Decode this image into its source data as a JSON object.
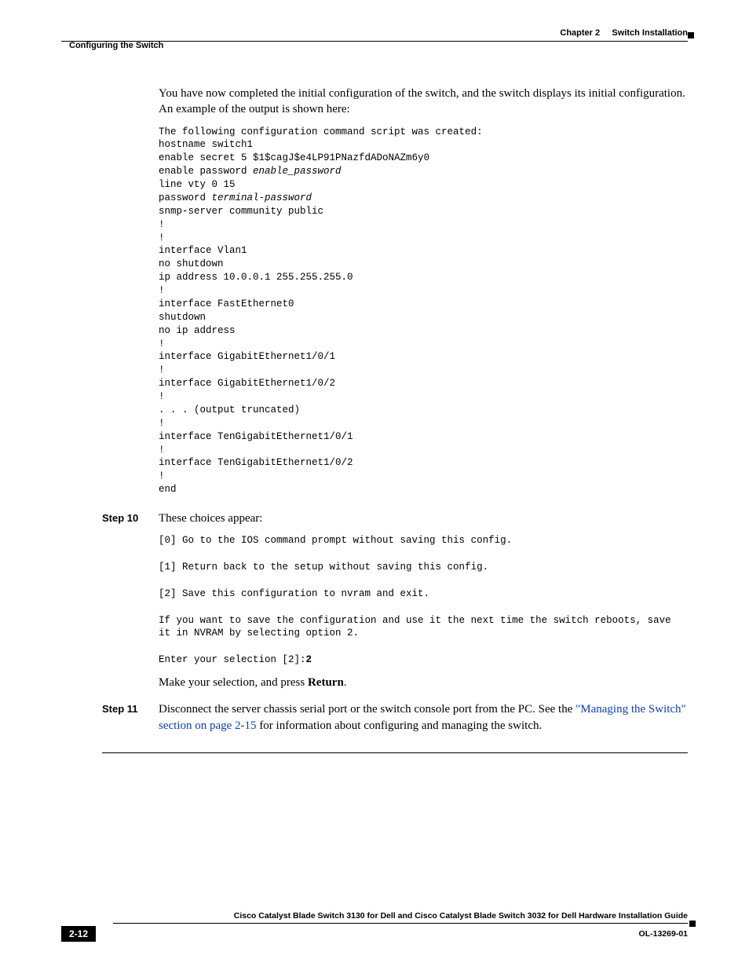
{
  "header": {
    "chapter_label": "Chapter 2",
    "chapter_title": "Switch Installation",
    "section_title": "Configuring the Switch"
  },
  "intro_para": "You have now completed the initial configuration of the switch, and the switch displays its initial configuration. An example of the output is shown here:",
  "code1": {
    "l1": "The following configuration command script was created:",
    "l2": "hostname switch1",
    "l3": "enable secret 5 $1$cagJ$e4LP91PNazfdADoNAZm6y0",
    "l4a": "enable password ",
    "l4b": "enable_password",
    "l5": "line vty 0 15",
    "l6a": "password ",
    "l6b": "terminal-password",
    "l7": "snmp-server community public",
    "l8": "!",
    "l9": "!",
    "l10": "interface Vlan1",
    "l11": "no shutdown",
    "l12": "ip address 10.0.0.1 255.255.255.0",
    "l13": "!",
    "l14": "interface FastEthernet0",
    "l15": "shutdown",
    "l16": "no ip address",
    "l17": "!",
    "l18": "interface GigabitEthernet1/0/1",
    "l19": "!",
    "l20": "interface GigabitEthernet1/0/2",
    "l21": "!",
    "l22": ". . . (output truncated)",
    "l23": "!",
    "l24": "interface TenGigabitEthernet1/0/1",
    "l25": "!",
    "l26": "interface TenGigabitEthernet1/0/2",
    "l27": "!",
    "l28": "end"
  },
  "step10": {
    "label": "Step 10",
    "intro": "These choices appear:",
    "c1": "[0] Go to the IOS command prompt without saving this config.",
    "c2": "[1] Return back to the setup without saving this config.",
    "c3": "[2] Save this configuration to nvram and exit.",
    "c4": "If you want to save the configuration and use it the next time the switch reboots, save it in NVRAM by selecting option 2.",
    "c5a": "Enter your selection [2]:",
    "c5b": "2",
    "closing_a": "Make your selection, and press ",
    "closing_b": "Return",
    "closing_c": "."
  },
  "step11": {
    "label": "Step 11",
    "text_a": "Disconnect the server chassis serial port or the switch console port from the PC. See the ",
    "link": "\"Managing the Switch\" section on page 2-15",
    "text_b": " for information about configuring and managing the switch."
  },
  "footer": {
    "book_title": "Cisco Catalyst Blade Switch 3130 for Dell and Cisco Catalyst Blade Switch 3032 for Dell Hardware Installation Guide",
    "page_number": "2-12",
    "doc_id": "OL-13269-01"
  }
}
